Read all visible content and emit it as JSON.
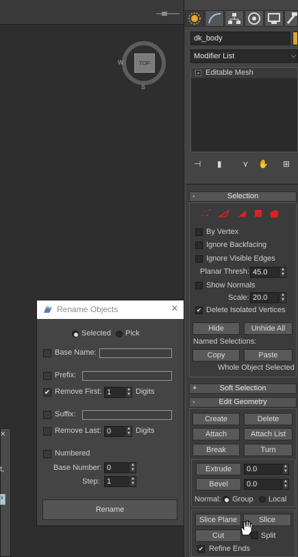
{
  "command_panel": {
    "object_name": "dk_body",
    "modifier_list_label": "Modifier List",
    "stack_item": "Editable Mesh",
    "stack_item_toggle": "+"
  },
  "selection_rollout": {
    "title": "Selection",
    "sign": "-",
    "by_vertex": "By Vertex",
    "ignore_backfacing": "Ignore Backfacing",
    "ignore_visible_edges": "Ignore Visible Edges",
    "planar_thresh_label": "Planar Thresh:",
    "planar_thresh_value": "45.0",
    "show_normals": "Show Normals",
    "scale_label": "Scale:",
    "scale_value": "20.0",
    "delete_isolated": "Delete Isolated Vertices",
    "delete_isolated_checked": true,
    "hide": "Hide",
    "unhide_all": "Unhide All",
    "named_selections": "Named Selections:",
    "copy": "Copy",
    "paste": "Paste",
    "status": "Whole Object Selected"
  },
  "soft_selection": {
    "title": "Soft Selection",
    "sign": "+"
  },
  "edit_geometry": {
    "title": "Edit Geometry",
    "sign": "-",
    "create": "Create",
    "delete": "Delete",
    "attach": "Attach",
    "attach_list": "Attach List",
    "break": "Break",
    "turn": "Turn",
    "extrude": "Extrude",
    "extrude_value": "0.0",
    "bevel": "Bevel",
    "bevel_value": "0.0",
    "normal_label": "Normal:",
    "group": "Group",
    "local": "Local",
    "slice_plane": "Slice Plane",
    "slice": "Slice",
    "cut": "Cut",
    "split": "Split",
    "refine_ends": "Refine Ends",
    "refine_ends_checked": true
  },
  "viewport": {
    "viewcube_face": "TOP",
    "compass_w": "W",
    "compass_s": "S",
    "left_text_1": "t,",
    "left_text_2": "x"
  },
  "rename_dialog": {
    "title": "Rename Objects",
    "close": "✕",
    "selected": "Selected",
    "pick": "Pick",
    "base_name": "Base Name:",
    "prefix": "Prefix:",
    "remove_first": "Remove First:",
    "remove_first_value": "1",
    "digits_1": "Digits",
    "suffix": "Suffix:",
    "remove_last": "Remove Last:",
    "remove_last_value": "0",
    "digits_2": "Digits",
    "numbered": "Numbered",
    "base_number": "Base Number:",
    "base_number_value": "0",
    "step": "Step:",
    "step_value": "1",
    "rename_button": "Rename"
  },
  "colors": {
    "accent": "#e8a830",
    "vertex_red": "#e02020"
  }
}
